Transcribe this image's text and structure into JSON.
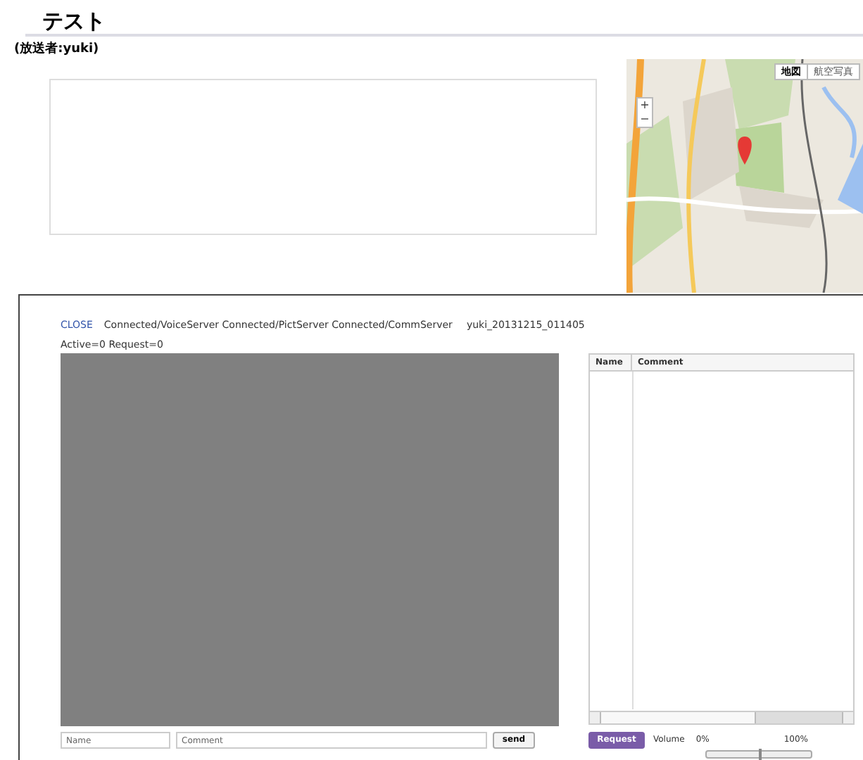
{
  "page": {
    "title": "テスト",
    "broadcaster": "(放送者:yuki)"
  },
  "map": {
    "kind": "picture",
    "map_types": [
      {
        "label": "地図",
        "selected": true
      },
      {
        "label": "航空写真",
        "selected": false
      }
    ],
    "zoom": [
      "+",
      "−"
    ]
  },
  "player": {
    "close": "CLOSE",
    "status": "Connected/VoiceServer Connected/PictServer Connected/CommServer",
    "session": "yuki_20131215_011405",
    "counts": "Active=0 Request=0",
    "chat": {
      "columns": [
        "Name",
        "Comment"
      ]
    },
    "name_field": {
      "placeholder": "Name"
    },
    "comment_field": {
      "placeholder": "Comment"
    },
    "send": "send",
    "request": "Request",
    "volume": {
      "label": "Volume",
      "min": "0%",
      "max": "100%",
      "level": 0.5
    }
  }
}
